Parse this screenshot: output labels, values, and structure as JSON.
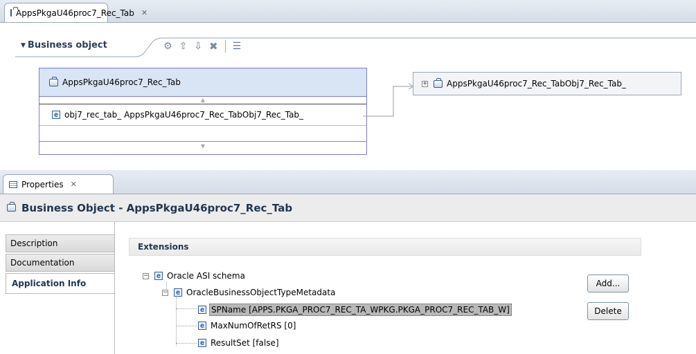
{
  "editor": {
    "tab_title": "AppsPkgaU46proc7_Rec_Tab",
    "section_label": "Business object",
    "main_node": {
      "title": "AppsPkgaU46proc7_Rec_Tab",
      "field_label": "obj7_rec_tab_ AppsPkgaU46proc7_Rec_TabObj7_Rec_Tab_"
    },
    "linked_node": {
      "title": "AppsPkgaU46proc7_Rec_TabObj7_Rec_Tab_"
    }
  },
  "properties": {
    "tab_title": "Properties",
    "header_title": "Business Object - AppsPkgaU46proc7_Rec_Tab",
    "side_tabs": [
      {
        "label": "Description"
      },
      {
        "label": "Documentation"
      },
      {
        "label": "Application Info"
      }
    ],
    "section_title": "Extensions",
    "tree": {
      "root": "Oracle ASI schema",
      "child": "OracleBusinessObjectTypeMetadata",
      "leaves": [
        {
          "label": "SPName [APPS.PKGA_PROC7_REC_TA_WPKG.PKGA_PROC7_REC_TAB_W]"
        },
        {
          "label": "MaxNumOfRetRS [0]"
        },
        {
          "label": "ResultSet [false]"
        }
      ]
    },
    "add_label": "Add...",
    "delete_label": "Delete"
  },
  "colors": {
    "selected_tab": "#ffffff",
    "node_header": "#d9e4f5",
    "selected_field": "#b9b9b9",
    "accent": "#2f5d9f"
  }
}
